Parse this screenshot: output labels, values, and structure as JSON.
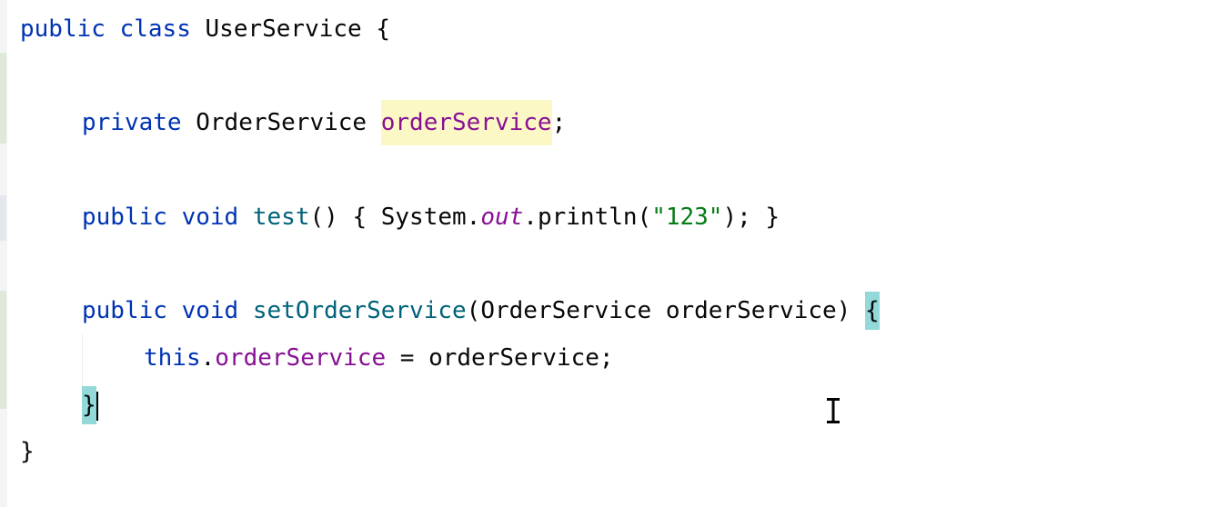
{
  "editor": {
    "lines": [
      {
        "id": "class-declaration",
        "tokens": [
          {
            "text": "public",
            "type": "kw"
          },
          {
            "text": " ",
            "type": "plain"
          },
          {
            "text": "class",
            "type": "kw"
          },
          {
            "text": " UserService {",
            "type": "plain"
          }
        ]
      },
      {
        "id": "field-declaration",
        "tokens": [
          {
            "text": "private",
            "type": "kw"
          },
          {
            "text": " OrderService ",
            "type": "plain"
          },
          {
            "text": "orderService",
            "type": "hl-field"
          },
          {
            "text": ";",
            "type": "plain"
          }
        ]
      },
      {
        "id": "test-method",
        "tokens": [
          {
            "text": "public",
            "type": "kw"
          },
          {
            "text": " ",
            "type": "plain"
          },
          {
            "text": "void",
            "type": "kw"
          },
          {
            "text": " ",
            "type": "plain"
          },
          {
            "text": "test",
            "type": "method"
          },
          {
            "text": "() { System.",
            "type": "plain"
          },
          {
            "text": "out",
            "type": "static"
          },
          {
            "text": ".println(",
            "type": "plain"
          },
          {
            "text": "\"123\"",
            "type": "str"
          },
          {
            "text": "); }",
            "type": "plain"
          }
        ]
      },
      {
        "id": "setter-signature",
        "tokens": [
          {
            "text": "public",
            "type": "kw"
          },
          {
            "text": " ",
            "type": "plain"
          },
          {
            "text": "void",
            "type": "kw"
          },
          {
            "text": " ",
            "type": "plain"
          },
          {
            "text": "setOrderService",
            "type": "method"
          },
          {
            "text": "(OrderService orderService) ",
            "type": "plain"
          },
          {
            "text": "{",
            "type": "hl-brace"
          }
        ]
      },
      {
        "id": "setter-body",
        "tokens": [
          {
            "text": "this",
            "type": "kw"
          },
          {
            "text": ".",
            "type": "plain"
          },
          {
            "text": "orderService",
            "type": "field"
          },
          {
            "text": " = orderService;",
            "type": "plain"
          }
        ]
      },
      {
        "id": "setter-close",
        "tokens": [
          {
            "text": "}",
            "type": "hl-brace"
          }
        ],
        "caret": true
      },
      {
        "id": "class-close",
        "tokens": [
          {
            "text": "}",
            "type": "plain"
          }
        ]
      }
    ]
  },
  "colors": {
    "keyword": "#0033b3",
    "field": "#871094",
    "method": "#00627a",
    "string": "#067d17",
    "text": "#080808",
    "field_highlight_bg": "#fcf8c6",
    "brace_match_bg": "#93d9d9"
  },
  "icons": {
    "mouse_cursor": "text-ibeam-cursor-icon"
  }
}
